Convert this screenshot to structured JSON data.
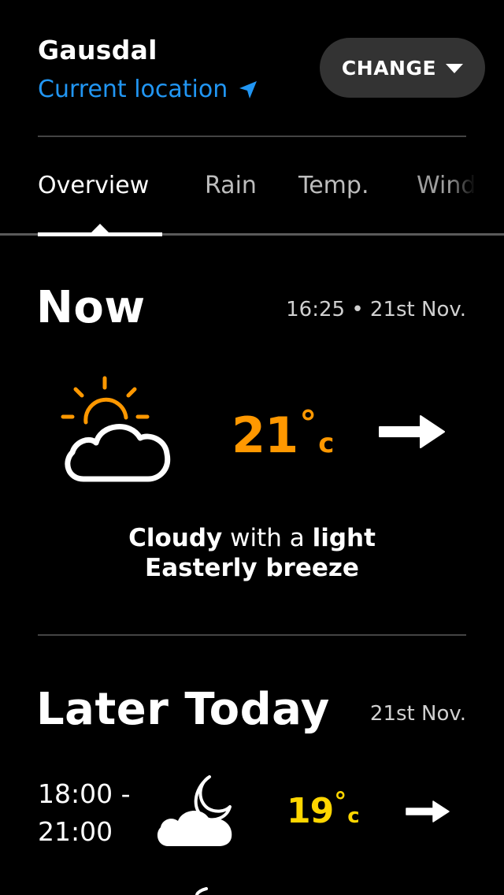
{
  "header": {
    "city": "Gausdal",
    "current_location": "Current location",
    "change_label": "CHANGE"
  },
  "tabs": [
    {
      "label": "Overview",
      "active": true
    },
    {
      "label": "Rain",
      "active": false
    },
    {
      "label": "Temp.",
      "active": false
    },
    {
      "label": "Wind",
      "active": false
    }
  ],
  "now": {
    "title": "Now",
    "timestamp": "16:25 • 21st Nov.",
    "temperature": "21",
    "degree_symbol": "°",
    "unit": "c",
    "summary": {
      "part1": "Cloudy",
      "part2": " with a ",
      "part3": "light",
      "part4": "Easterly breeze"
    },
    "icon": "partly-cloudy-day-icon",
    "wind_icon": "wind-arrow-east-icon"
  },
  "later": {
    "title": "Later Today",
    "date": "21st Nov.",
    "rows": [
      {
        "period_line1": "18:00 -",
        "period_line2": "21:00",
        "temperature": "19",
        "degree_symbol": "°",
        "unit": "c",
        "icon": "cloudy-night-icon",
        "wind_icon": "wind-arrow-east-icon"
      }
    ]
  },
  "colors": {
    "background": "#000000",
    "accent_blue": "#2196f3",
    "temp_now": "#ff9800",
    "temp_later": "#ffd600",
    "button_bg": "#333333"
  }
}
